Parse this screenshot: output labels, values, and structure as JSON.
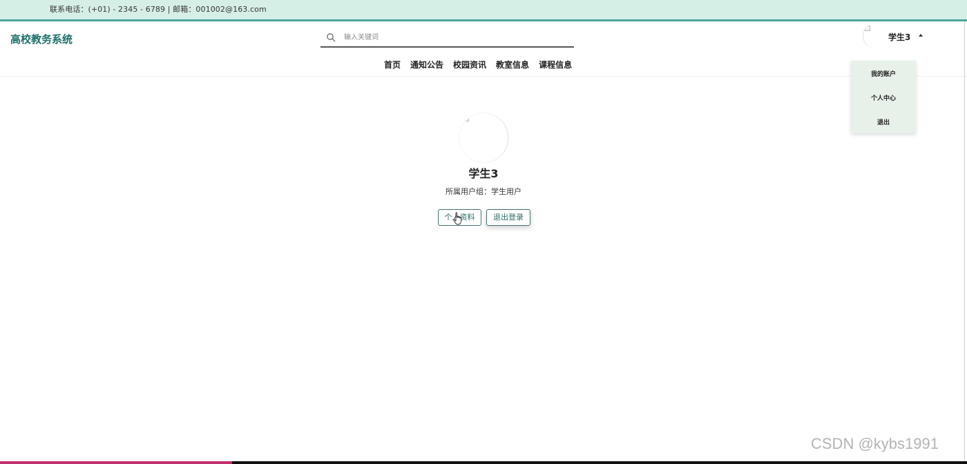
{
  "topbar": {
    "contact_text": "联系电话：(+01) - 2345 - 6789 | 邮箱：001002@163.com"
  },
  "header": {
    "logo": "高校教务系统",
    "search": {
      "placeholder": "输入关键词",
      "value": ""
    },
    "nav": [
      "首页",
      "通知公告",
      "校园资讯",
      "教室信息",
      "课程信息"
    ],
    "user": {
      "name": "学生3"
    }
  },
  "dropdown": {
    "items": [
      "我的账户",
      "个人中心",
      "退出"
    ]
  },
  "profile": {
    "name": "学生3",
    "group_label": "所属用户组：",
    "group_value": "学生用户",
    "buttons": {
      "profile": "个人资料",
      "logout": "退出登录"
    }
  },
  "watermark": "CSDN @kybs1991",
  "progress": {
    "fraction": 0.24
  },
  "colors": {
    "topbar_bg": "#d6efe6",
    "accent": "#1c6f6a",
    "dropdown_bg": "#e7f1ea",
    "progress_fill": "#c3306f"
  }
}
